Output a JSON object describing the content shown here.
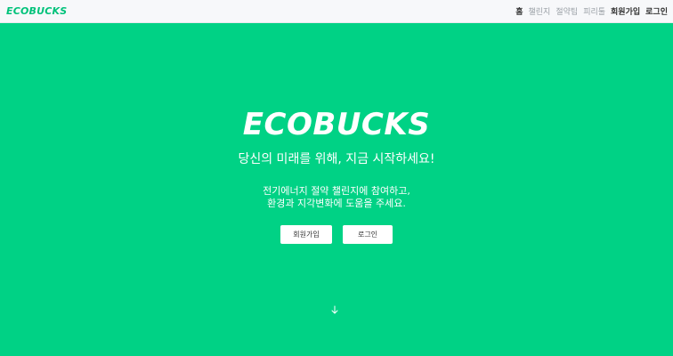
{
  "brand": "ECOBUCKS",
  "nav": {
    "items": [
      {
        "label": "홈"
      },
      {
        "label": "챌린지"
      },
      {
        "label": "절약팁"
      },
      {
        "label": "피리툴"
      },
      {
        "label": "회원가입"
      },
      {
        "label": "로그인"
      }
    ]
  },
  "hero": {
    "title": "ECOBUCKS",
    "tagline": "당신의 미래를 위해, 지금 시작하세요!",
    "desc_line1": "전기에너지 절약 챌린지에 참여하고,",
    "desc_line2": "환경과 지각변화에 도움을 주세요.",
    "signup_label": "회원가입",
    "login_label": "로그인",
    "scroll_icon": "arrow-down-icon"
  },
  "colors": {
    "accent": "#00d285",
    "brand_text": "#00c27a",
    "navbar_bg": "#f7f8fa"
  }
}
